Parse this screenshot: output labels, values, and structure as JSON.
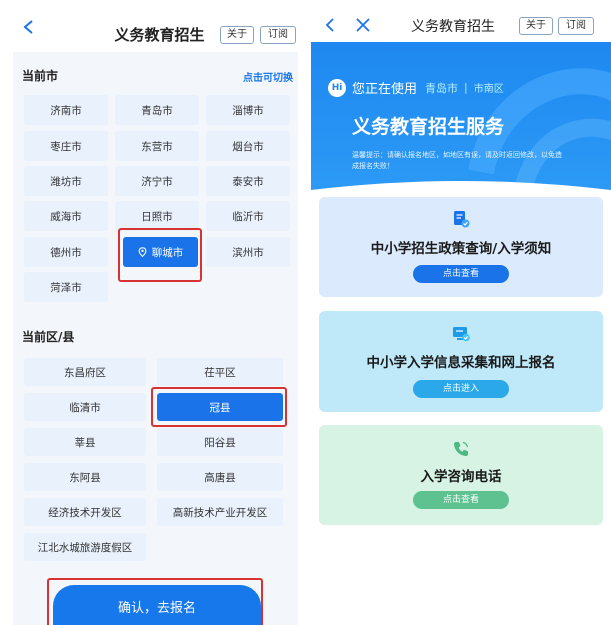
{
  "left": {
    "title": "义务教育招生",
    "about_label": "关于",
    "subscribe_label": "订阅",
    "city_section_title": "当前市",
    "switch_label": "点击可切换",
    "cities": [
      "济南市",
      "青岛市",
      "淄博市",
      "枣庄市",
      "东营市",
      "烟台市",
      "潍坊市",
      "济宁市",
      "泰安市",
      "威海市",
      "日照市",
      "临沂市",
      "德州市",
      "聊城市",
      "滨州市",
      "菏泽市"
    ],
    "selected_city": "聊城市",
    "district_section_title": "当前区/县",
    "districts": [
      "东昌府区",
      "茌平区",
      "临清市",
      "冠县",
      "莘县",
      "阳谷县",
      "东阿县",
      "高唐县",
      "经济技术开发区",
      "高新技术产业开发区",
      "江北水城旅游度假区"
    ],
    "selected_district": "冠县",
    "confirm_label": "确认，去报名"
  },
  "right": {
    "title": "义务教育招生",
    "about_label": "关于",
    "subscribe_label": "订阅",
    "hi_badge": "Hi",
    "using_text": "您正在使用",
    "city_tag": "青岛市",
    "tag_separator": "|",
    "district_tag": "市南区",
    "hero_title": "义务教育招生服务",
    "hero_tip": "温馨提示：请确认报名地区，如地区有误，请及时返回修改，以免造成报名失败！",
    "services": [
      {
        "title": "中小学招生政策查询/入学须知",
        "button": "点击查看",
        "icon": "document-check-icon"
      },
      {
        "title": "中小学入学信息采集和网上报名",
        "button": "点击进入",
        "icon": "monitor-check-icon"
      },
      {
        "title": "入学咨询电话",
        "button": "点击查看",
        "icon": "phone-icon"
      }
    ]
  },
  "colors": {
    "primary_blue": "#1a73e8",
    "highlight_red": "#d73333",
    "hero_blue": "#1e88f0",
    "card1_bg": "#dbeafc",
    "card2_bg": "#bfe9f9",
    "card3_bg": "#d6f3e3",
    "card3_button": "#5ec190"
  }
}
